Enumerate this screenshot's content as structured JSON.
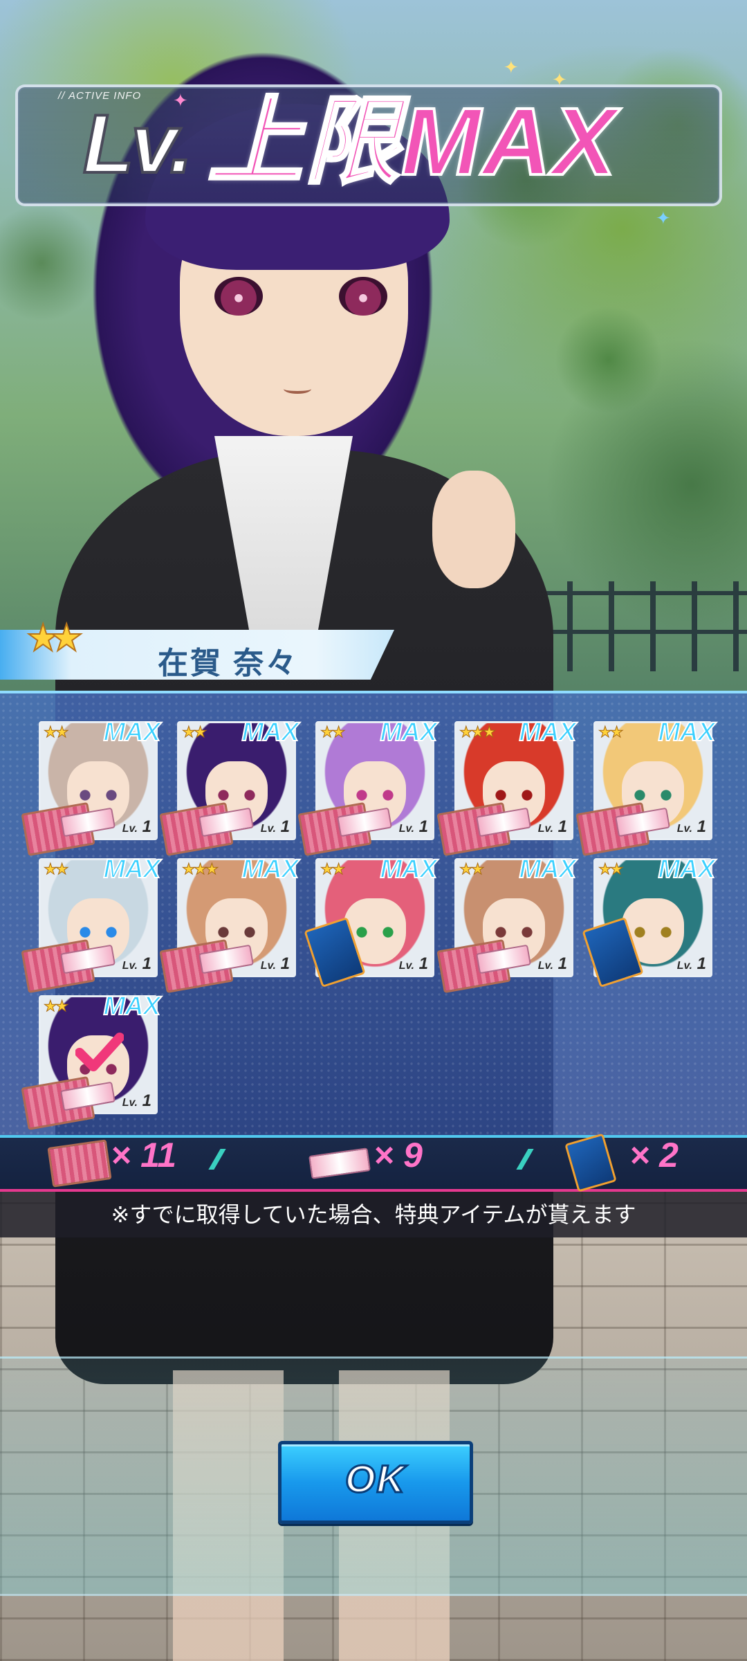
{
  "header": {
    "active_info": "// ACTIVE INFO",
    "title_lv": "Lv.",
    "title_main": "上限MAX"
  },
  "character": {
    "name": "在賀 奈々",
    "stars": "★★"
  },
  "cards": [
    {
      "stars": "★★",
      "max": "MAX",
      "lv_prefix": "Lv.",
      "lv": "1",
      "hair": "#c9b4a8",
      "eye": "#6a4a80",
      "item": "meat"
    },
    {
      "stars": "★★",
      "max": "MAX",
      "lv_prefix": "Lv.",
      "lv": "1",
      "hair": "#3a1d6e",
      "eye": "#8e2a5c",
      "item": "meat"
    },
    {
      "stars": "★★",
      "max": "MAX",
      "lv_prefix": "Lv.",
      "lv": "1",
      "hair": "#b07ad6",
      "eye": "#c03a8a",
      "item": "meat"
    },
    {
      "stars": "★★★",
      "max": "MAX",
      "lv_prefix": "Lv.",
      "lv": "1",
      "hair": "#d83a2a",
      "eye": "#a01818",
      "item": "meat"
    },
    {
      "stars": "★★",
      "max": "MAX",
      "lv_prefix": "Lv.",
      "lv": "1",
      "hair": "#f2c878",
      "eye": "#2a8a6a",
      "item": "meat"
    },
    {
      "stars": "★★",
      "max": "MAX",
      "lv_prefix": "Lv.",
      "lv": "1",
      "hair": "#c8d8e2",
      "eye": "#2a8ae8",
      "item": "meat"
    },
    {
      "stars": "★★★",
      "max": "MAX",
      "lv_prefix": "Lv.",
      "lv": "1",
      "hair": "#d49a74",
      "eye": "#6a3a3a",
      "item": "meat"
    },
    {
      "stars": "★★",
      "max": "MAX",
      "lv_prefix": "Lv.",
      "lv": "1",
      "hair": "#e4607a",
      "eye": "#2aa04a",
      "item": "card"
    },
    {
      "stars": "★★",
      "max": "MAX",
      "lv_prefix": "Lv.",
      "lv": "1",
      "hair": "#c89070",
      "eye": "#7a3a3a",
      "item": "meat"
    },
    {
      "stars": "★★",
      "max": "MAX",
      "lv_prefix": "Lv.",
      "lv": "1",
      "hair": "#2a7a80",
      "eye": "#a08020",
      "item": "card"
    },
    {
      "stars": "★★",
      "max": "MAX",
      "lv_prefix": "Lv.",
      "lv": "1",
      "hair": "#3a1d6e",
      "eye": "#8e2a5c",
      "item": "meat",
      "checked": true
    }
  ],
  "rewards": [
    {
      "icon": "meat-box-icon",
      "count": "× 11"
    },
    {
      "icon": "ticket-icon",
      "count": "× 9"
    },
    {
      "icon": "blue-card-icon",
      "count": "× 2"
    }
  ],
  "notice": "※すでに取得していた場合、特典アイテムが貰えます",
  "ok_label": "OK",
  "colors": {
    "title_pink": "#f255b7",
    "max_cyan": "#3ad0ff",
    "reward_pink": "#ff74c8",
    "button_blue": "#1899ec"
  }
}
